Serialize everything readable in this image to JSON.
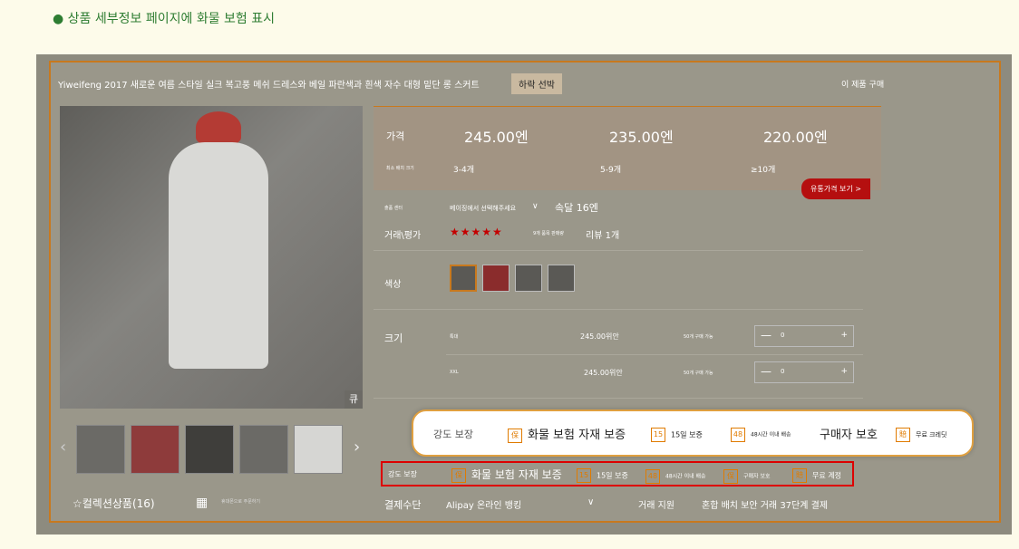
{
  "caption": "● 상품 세부정보 페이지에 화물 보험 표시",
  "product": {
    "title": "Yiweifeng 2017 새로운 여름 스타일 실크 복고풍 메쉬 드레스와 베일 파란색과 흰색 자수 대형 밑단 롱 스커트",
    "hot_tag": "하락 선박",
    "buy_link": "이 제품 구매",
    "zoom_label": "큐"
  },
  "gallery": {
    "prev_arrow": "‹",
    "next_arrow": "›",
    "collection": "☆컬렉션상품(16)",
    "share_tiny": "휴대폰으로 주문하기"
  },
  "pricing": {
    "price_label": "가격",
    "qty_label": "최소 배치 크기",
    "tiers": [
      {
        "price": "245.00엔",
        "qty": "3-4개"
      },
      {
        "price": "235.00엔",
        "qty": "5-9개"
      },
      {
        "price": "220.00엔",
        "qty": "≥10개"
      }
    ],
    "wholesale_button": "유통가격 보기 >"
  },
  "shipping": {
    "label": "출품 센터",
    "from": "베이징에서 선택해주세요",
    "chevron": "∨",
    "speed": "속달 16엔"
  },
  "rating": {
    "label": "거래\\평가",
    "stars": "★★★★★",
    "mini": "9개 품목 판매량",
    "reviews": "리뷰 1개"
  },
  "color_label": "색상",
  "size": {
    "label": "크기",
    "rows": [
      {
        "name": "특대",
        "price": "245.00위안",
        "avail": "50개 구매 가능",
        "minus": "—",
        "qty": "0",
        "plus": "+"
      },
      {
        "name": "XXL",
        "price": "245.00위안",
        "avail": "50개 구매 가능",
        "minus": "—",
        "qty": "0",
        "plus": "+"
      }
    ]
  },
  "highlight": {
    "label": "강도 보장",
    "items": [
      {
        "badge": "保",
        "text": "화물 보험 자재 보증"
      },
      {
        "badge": "15",
        "text": "15일 보증"
      },
      {
        "badge": "48",
        "text": "48시간 이내 배송"
      },
      {
        "badge": "",
        "text": "구매자 보호"
      },
      {
        "badge": "賠",
        "text": "무료 크레딧"
      }
    ]
  },
  "guarantee_row": {
    "label": "강도 보장",
    "items": [
      {
        "badge": "保",
        "text": "화물 보험 자재 보증"
      },
      {
        "badge": "15",
        "text": "15일 보증"
      },
      {
        "badge": "48",
        "text": "48시간 이내 배송"
      },
      {
        "badge": "保",
        "text": "구매자 보호"
      },
      {
        "badge": "賠",
        "text": "무료 계정"
      }
    ]
  },
  "payment": {
    "label": "결제수단",
    "method": "Alipay 온라인 뱅킹",
    "chevron": "∨",
    "support": "거래 지원",
    "info": "혼합 배치 보안 거래 37단계 결제"
  },
  "colors": {
    "accent": "#c8791e",
    "caption_green": "#2e7d32",
    "star_red": "#c40000",
    "button_red": "#b50f0f",
    "badge_orange": "#e07b00"
  }
}
